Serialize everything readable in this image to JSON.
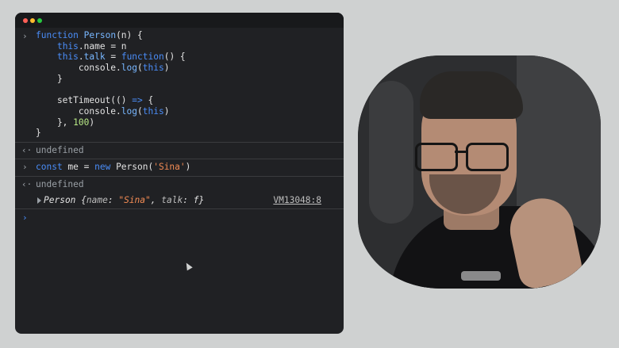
{
  "window": {
    "controls": [
      "close",
      "minimize",
      "maximize"
    ],
    "control_colors": {
      "close": "#ff5f57",
      "minimize": "#febc2e",
      "maximize": "#28c840"
    }
  },
  "console": {
    "entry1": {
      "lines": [
        "function Person(n) {",
        "    this.name = n",
        "    this.talk = function() {",
        "        console.log(this)",
        "    }",
        "",
        "    setTimeout(() => {",
        "        console.log(this)",
        "    }, 100)",
        "}"
      ],
      "result": "undefined"
    },
    "entry2": {
      "code": "const me = new Person('Sina')",
      "result": "undefined"
    },
    "log_output": {
      "class_name": "Person",
      "open": " {",
      "key1": "name",
      "value1": "\"Sina\"",
      "key2": "talk",
      "value2": "f",
      "close": "}",
      "source_link": "VM13048:8"
    },
    "prompt_symbol": "›",
    "return_symbol": "‹·"
  },
  "colors": {
    "keyword": "#4a8df8",
    "string": "#f28b54",
    "number": "#b8e986",
    "console_bg": "#202124",
    "page_bg": "#cfd1d1"
  }
}
